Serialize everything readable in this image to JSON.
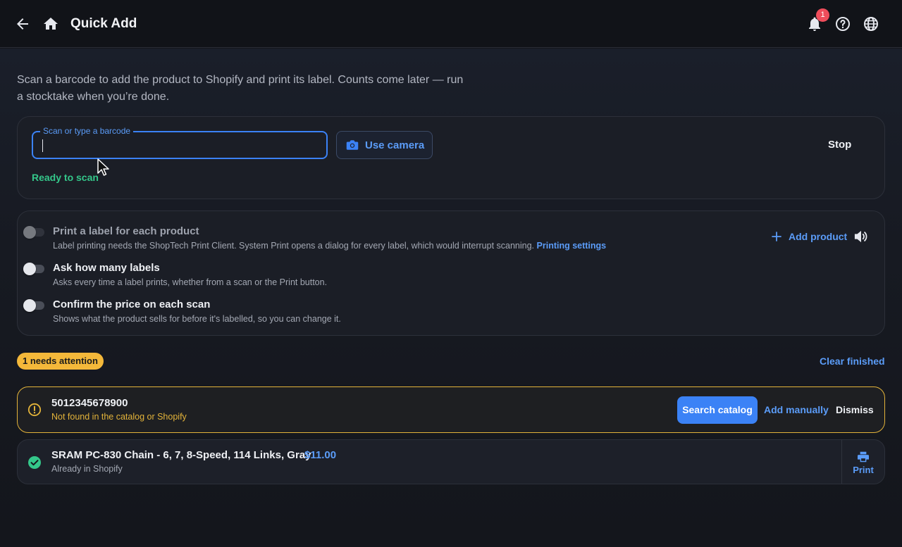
{
  "header": {
    "title": "Quick Add",
    "notification_count": "1"
  },
  "intro": {
    "text": "Scan a barcode to add the product to Shopify and print its label. Counts come later — run a stocktake when you’re done."
  },
  "scan": {
    "field_label": "Scan or type a barcode",
    "value": "",
    "camera_label": "Use camera",
    "stop_label": "Stop",
    "status": "Ready to scan"
  },
  "options": [
    {
      "title": "Print a label for each product",
      "desc": "Label printing needs the ShopTech Print Client. System Print opens a dialog for every label, which would interrupt scanning.",
      "link": "Printing settings",
      "enabled": false,
      "disabled": true
    },
    {
      "title": "Ask how many labels",
      "desc": "Asks every time a label prints, whether from a scan or the Print button.",
      "enabled": false
    },
    {
      "title": "Confirm the price on each scan",
      "desc": "Shows what the product sells for before it's labelled, so you can change it.",
      "enabled": false
    }
  ],
  "actions": {
    "add_product": "Add product"
  },
  "queue": {
    "attention_badge": "1 needs attention",
    "clear_finished": "Clear finished",
    "items": [
      {
        "code": "5012345678900",
        "status": "Not found in the catalog or Shopify",
        "search_label": "Search catalog",
        "manual_label": "Add manually",
        "dismiss_label": "Dismiss"
      },
      {
        "name": "SRAM PC-830 Chain - 6, 7, 8-Speed, 114 Links, Gray",
        "price": "$11.00",
        "status": "Already in Shopify",
        "print_label": "Print"
      }
    ]
  },
  "colors": {
    "accent": "#3b82f6",
    "success": "#34c78a",
    "warning": "#e3b33a",
    "badge": "#ef4d5b"
  }
}
